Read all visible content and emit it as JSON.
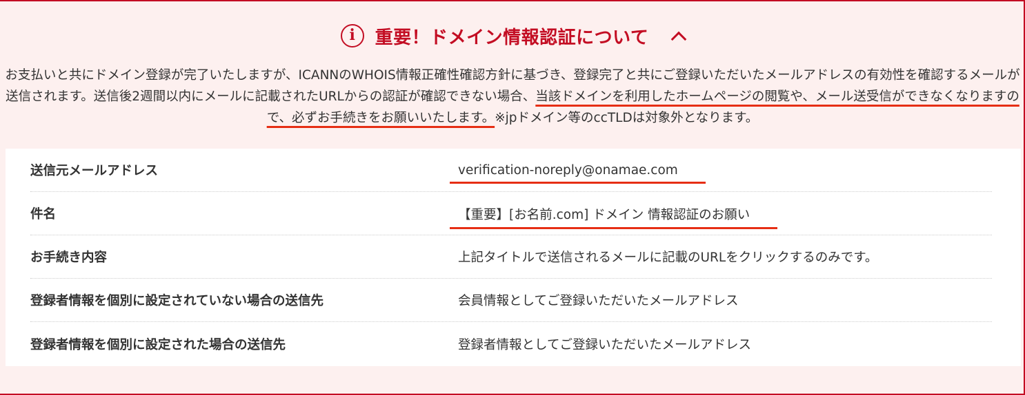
{
  "header": {
    "icon": "info-icon",
    "icon_glyph": "i",
    "title": "重要！ドメイン情報認証について",
    "chevron": "chevron-up-icon"
  },
  "description": {
    "part1": "お支払いと共にドメイン登録が完了いたしますが、ICANNのWHOIS情報正確性確認方針に基づき、登録完了と共にご登録いただいたメールアドレスの有効性を確認するメールが送信されます。送信後2週間以内にメールに記載されたURLからの認証が確認できない場合、",
    "highlight": "当該ドメインを利用したホームページの閲覧や、メール送受信ができなくなりますので、必ずお手続きをお願いいたします。",
    "part2": "※jpドメイン等のccTLDは対象外となります。"
  },
  "table": {
    "rows": [
      {
        "label": "送信元メールアドレス",
        "value": "verification-noreply@onamae.com"
      },
      {
        "label": "件名",
        "value": "【重要】[お名前.com] ドメイン 情報認証のお願い"
      },
      {
        "label": "お手続き内容",
        "value": "上記タイトルで送信されるメールに記載のURLをクリックするのみです。"
      },
      {
        "label": "登録者情報を個別に設定されていない場合の送信先",
        "value": "会員情報としてご登録いただいたメールアドレス"
      },
      {
        "label": "登録者情報を個別に設定された場合の送信先",
        "value": "登録者情報としてご登録いただいたメールアドレス"
      }
    ]
  },
  "colors": {
    "accent": "#c30d23",
    "underline": "#e62e14",
    "panel_bg": "#fdf0ef"
  }
}
